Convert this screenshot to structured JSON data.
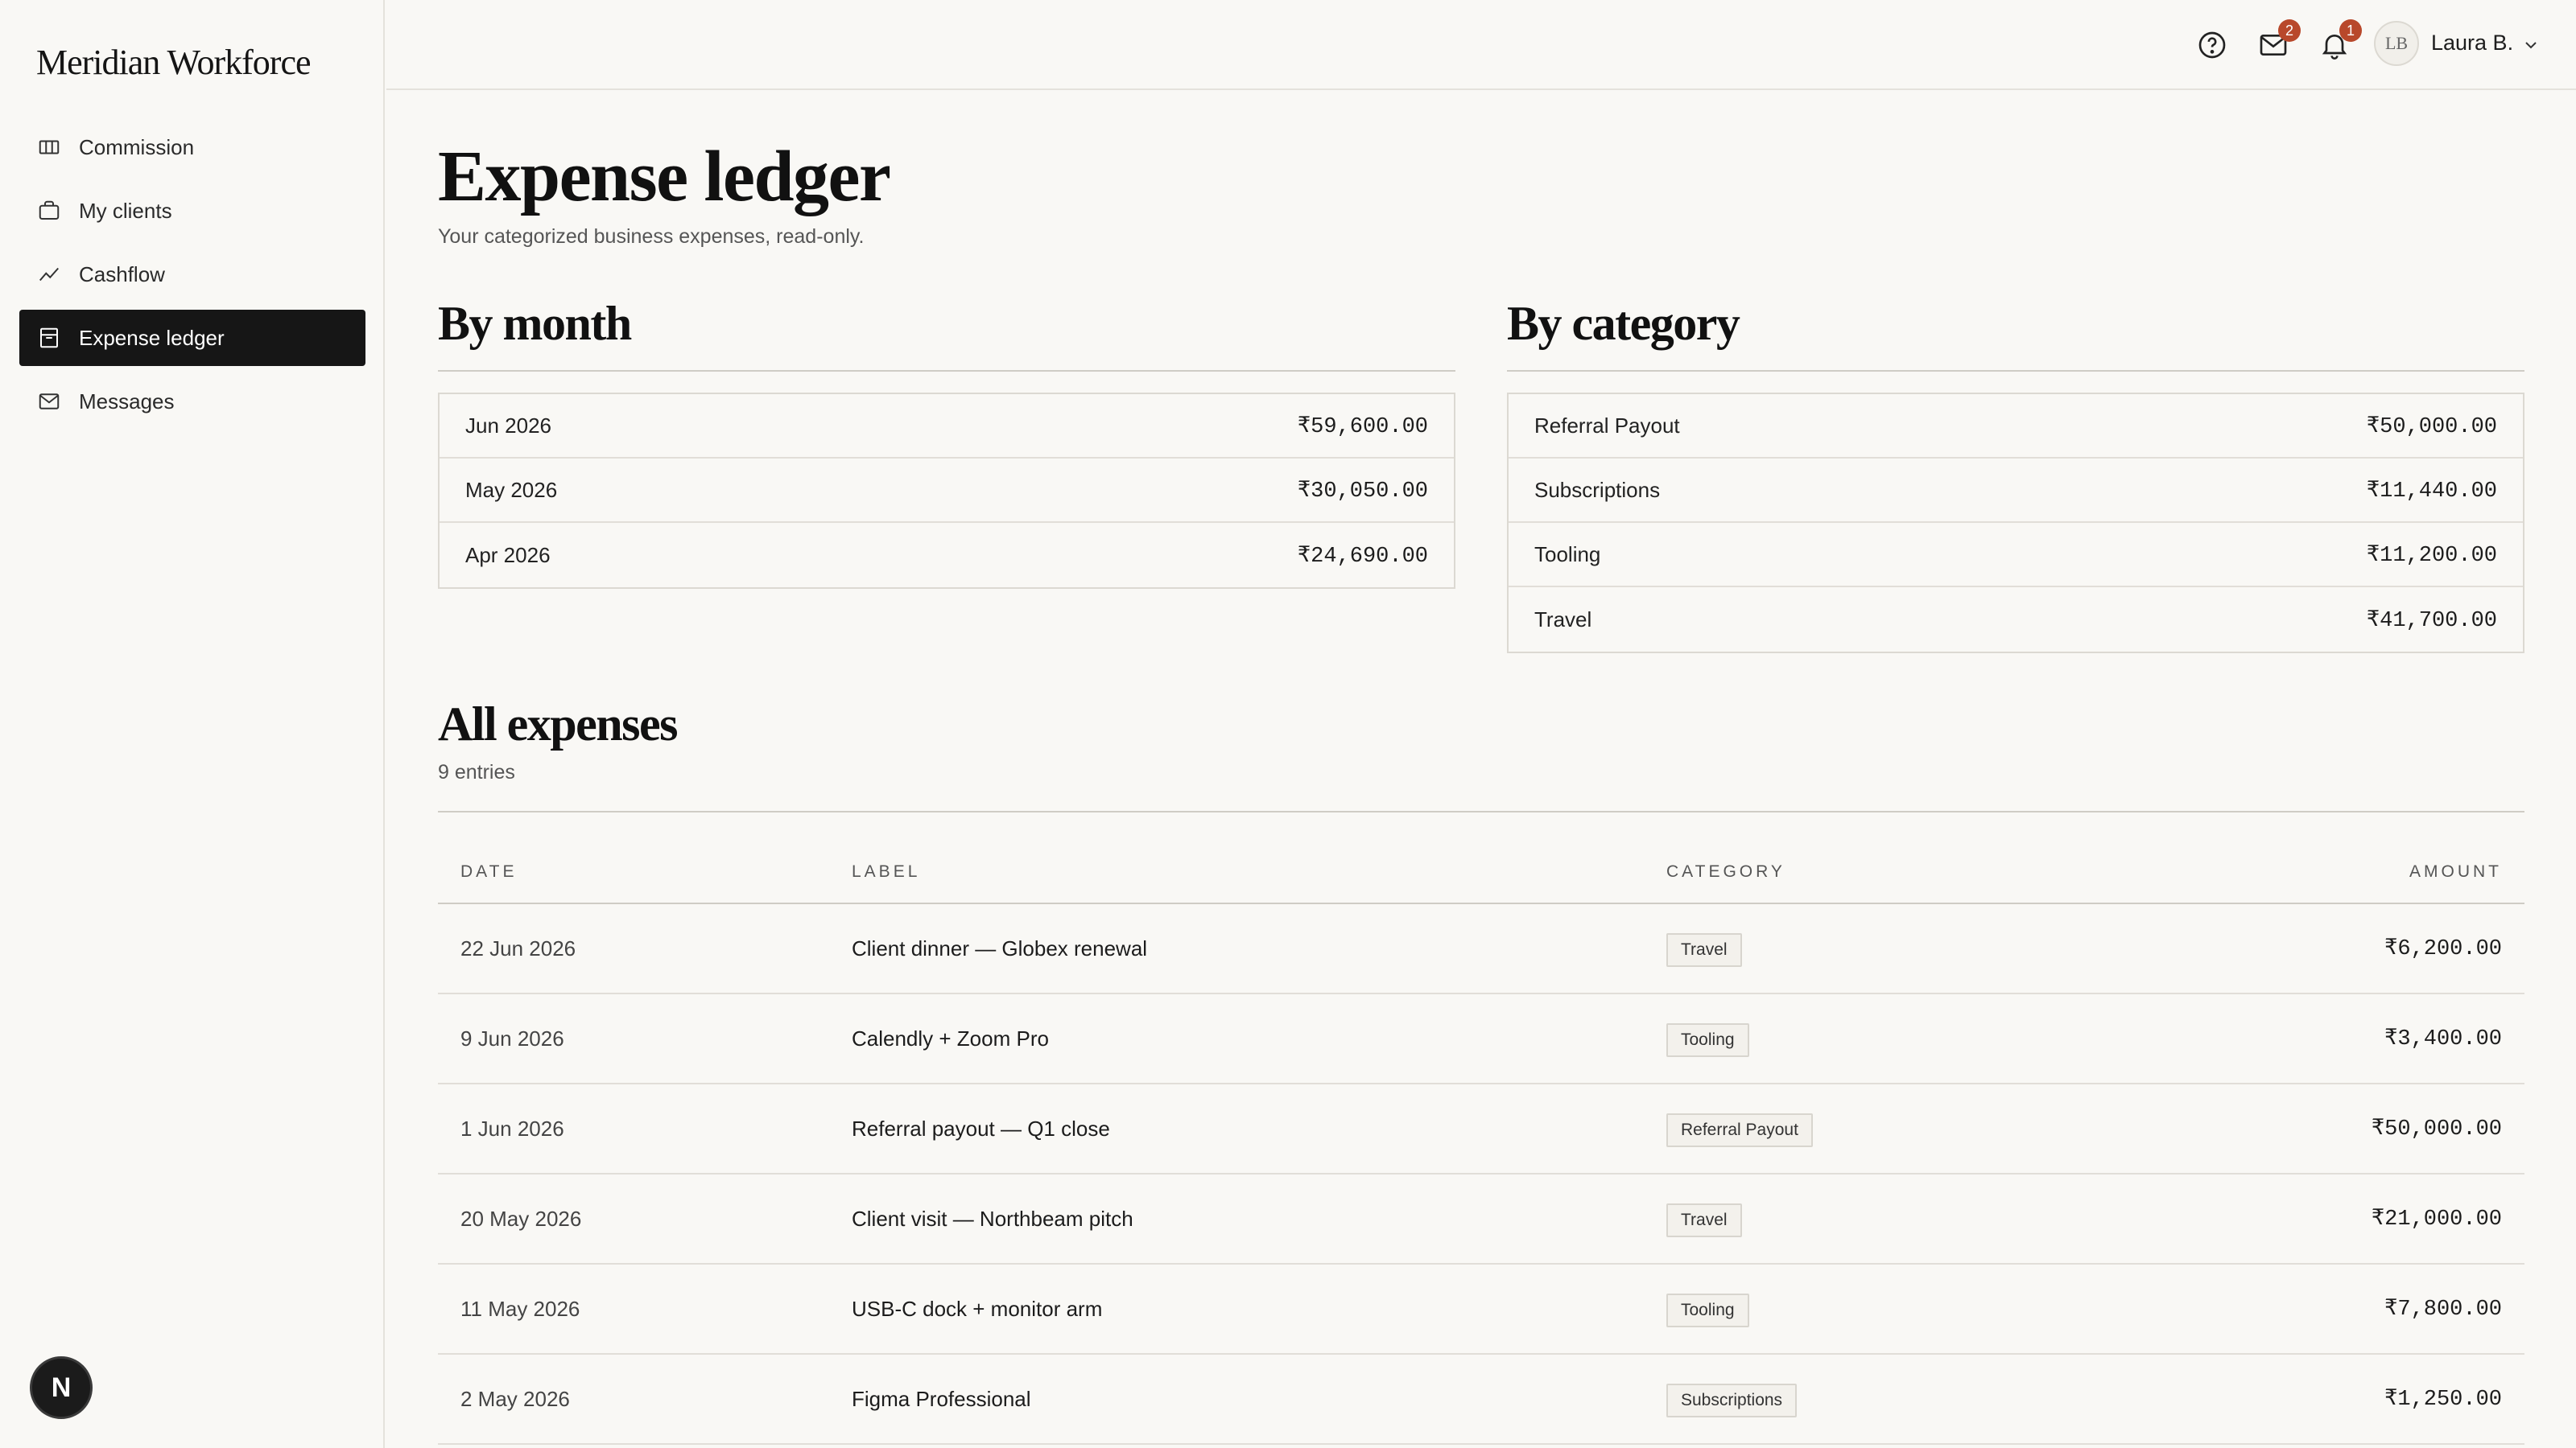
{
  "app": {
    "brand": "Meridian Workforce"
  },
  "sidebar": {
    "items": [
      {
        "label": "Commission",
        "icon": "table-icon",
        "active": false
      },
      {
        "label": "My clients",
        "icon": "briefcase-icon",
        "active": false
      },
      {
        "label": "Cashflow",
        "icon": "trend-line-icon",
        "active": false
      },
      {
        "label": "Expense ledger",
        "icon": "ledger-icon",
        "active": true
      },
      {
        "label": "Messages",
        "icon": "mail-icon",
        "active": false
      }
    ],
    "fab_label": "N"
  },
  "topbar": {
    "mail_badge": "2",
    "bell_badge": "1",
    "avatar_initials": "LB",
    "user_name": "Laura B."
  },
  "page": {
    "title": "Expense ledger",
    "subtitle": "Your categorized business expenses, read-only."
  },
  "by_month": {
    "title": "By month",
    "rows": [
      {
        "label": "Jun 2026",
        "amount": "₹59,600.00"
      },
      {
        "label": "May 2026",
        "amount": "₹30,050.00"
      },
      {
        "label": "Apr 2026",
        "amount": "₹24,690.00"
      }
    ]
  },
  "by_category": {
    "title": "By category",
    "rows": [
      {
        "label": "Referral Payout",
        "amount": "₹50,000.00"
      },
      {
        "label": "Subscriptions",
        "amount": "₹11,440.00"
      },
      {
        "label": "Tooling",
        "amount": "₹11,200.00"
      },
      {
        "label": "Travel",
        "amount": "₹41,700.00"
      }
    ]
  },
  "all_expenses": {
    "title": "All expenses",
    "count": "9 entries",
    "columns": {
      "date": "DATE",
      "label": "LABEL",
      "category": "CATEGORY",
      "amount": "AMOUNT"
    },
    "rows": [
      {
        "date": "22 Jun 2026",
        "label": "Client dinner — Globex renewal",
        "category": "Travel",
        "amount": "₹6,200.00"
      },
      {
        "date": "9 Jun 2026",
        "label": "Calendly + Zoom Pro",
        "category": "Tooling",
        "amount": "₹3,400.00"
      },
      {
        "date": "1 Jun 2026",
        "label": "Referral payout — Q1 close",
        "category": "Referral Payout",
        "amount": "₹50,000.00"
      },
      {
        "date": "20 May 2026",
        "label": "Client visit — Northbeam pitch",
        "category": "Travel",
        "amount": "₹21,000.00"
      },
      {
        "date": "11 May 2026",
        "label": "USB-C dock + monitor arm",
        "category": "Tooling",
        "amount": "₹7,800.00"
      },
      {
        "date": "2 May 2026",
        "label": "Figma Professional",
        "category": "Subscriptions",
        "amount": "₹1,250.00"
      }
    ]
  }
}
